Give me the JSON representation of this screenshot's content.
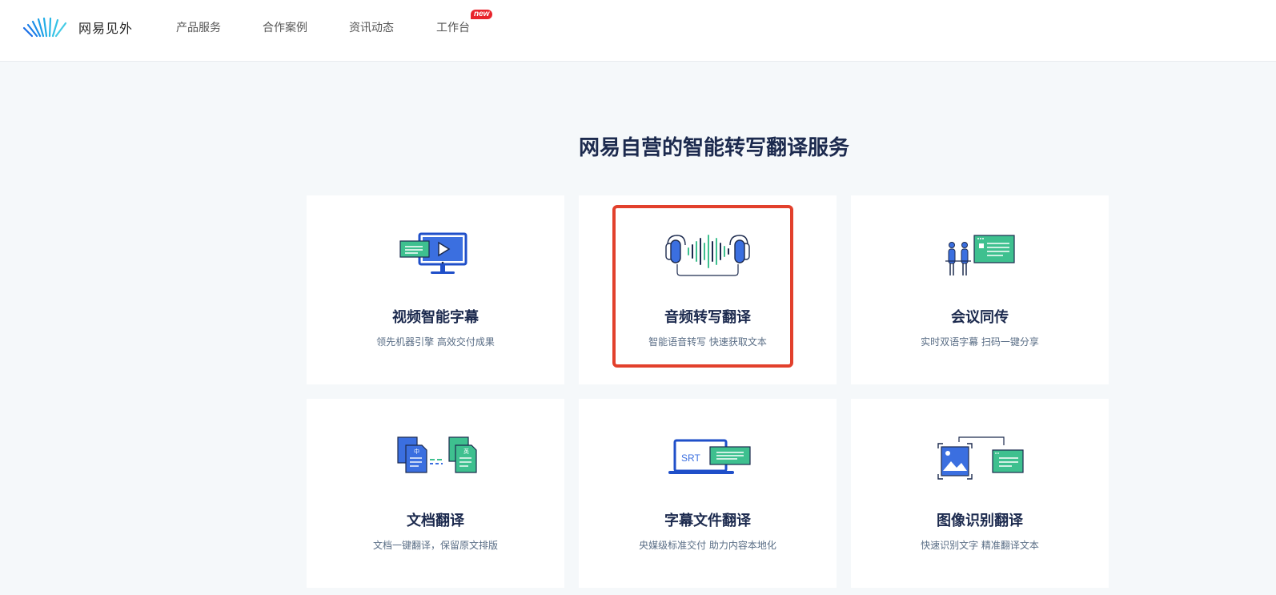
{
  "header": {
    "brand": "网易见外",
    "nav": [
      {
        "label": "产品服务"
      },
      {
        "label": "合作案例"
      },
      {
        "label": "资讯动态"
      },
      {
        "label": "工作台"
      }
    ],
    "badge": "new"
  },
  "main": {
    "headline": "网易自营的智能转写翻译服务",
    "cards": [
      {
        "title": "视频智能字幕",
        "subtitle": "领先机器引擎 高效交付成果",
        "icon": "video-subtitle-icon"
      },
      {
        "title": "音频转写翻译",
        "subtitle": "智能语音转写 快速获取文本",
        "icon": "audio-headphones-icon"
      },
      {
        "title": "会议同传",
        "subtitle": "实时双语字幕 扫码一键分享",
        "icon": "meeting-icon"
      },
      {
        "title": "文档翻译",
        "subtitle": "文档一键翻译，保留原文排版",
        "icon": "document-translate-icon"
      },
      {
        "title": "字幕文件翻译",
        "subtitle": "央媒级标准交付 助力内容本地化",
        "icon": "srt-file-icon"
      },
      {
        "title": "图像识别翻译",
        "subtitle": "快速识别文字 精准翻译文本",
        "icon": "image-ocr-icon"
      }
    ],
    "icon_labels": {
      "srt": "SRT",
      "zh": "中",
      "en": "英"
    }
  },
  "colors": {
    "accent_blue": "#3b6fe0",
    "accent_green": "#3ec08f",
    "navy": "#1c2a4e",
    "highlight_red": "#e2402c"
  }
}
